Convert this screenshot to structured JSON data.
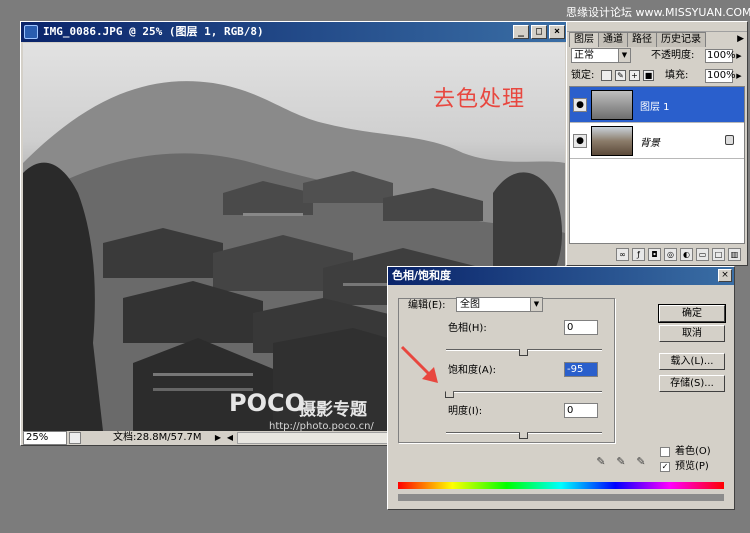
{
  "watermark_site": "思缘设计论坛 www.MISSYUAN.COM",
  "document": {
    "title": "IMG_0086.JPG @ 25% (图层 1, RGB/8)",
    "window_buttons": [
      "_",
      "□",
      "×"
    ],
    "overlay_title": "去色处理",
    "poco_logo": "POCO",
    "poco_title": "摄影专题",
    "poco_url": "http://photo.poco.cn/",
    "zoom": "25%",
    "doc_info": "文档:28.8M/57.7M",
    "nav_right": "▶",
    "nav_left": "◀"
  },
  "layers_panel": {
    "tabs": [
      "图层",
      "通道",
      "路径",
      "历史记录"
    ],
    "active_tab": "图层",
    "tab_menu": "▶",
    "blend_mode": "正常",
    "opacity_label": "不透明度:",
    "opacity_value": "100%",
    "lock_label": "锁定:",
    "fill_label": "填充:",
    "fill_value": "100%",
    "layers": [
      {
        "name": "图层 1",
        "selected": true
      },
      {
        "name": "背景",
        "selected": false
      }
    ],
    "bottom_icons": [
      "link-icon",
      "style-icon",
      "mask-icon",
      "set-icon",
      "adjust-icon",
      "folder-icon",
      "new-layer-icon",
      "trash-icon"
    ]
  },
  "dialog": {
    "title": "色相/饱和度",
    "close": "×",
    "edit_label": "编辑(E):",
    "edit_value": "全图",
    "hue_label": "色相(H):",
    "hue_value": "0",
    "saturation_label": "饱和度(A):",
    "saturation_value": "-95",
    "lightness_label": "明度(I):",
    "lightness_value": "0",
    "slider_range": [
      -100,
      100
    ],
    "buttons": {
      "ok": "确定",
      "cancel": "取消",
      "load": "载入(L)...",
      "save": "存储(S)..."
    },
    "colorize_label": "着色(O)",
    "colorize_checked": false,
    "preview_label": "预览(P)",
    "preview_checked": true,
    "check_mark": "✓",
    "eyedropper_glyph": "✎"
  }
}
